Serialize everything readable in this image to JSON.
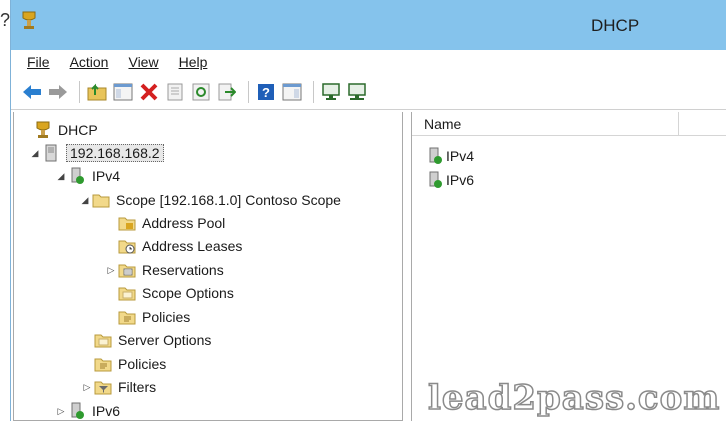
{
  "stray_char": "?",
  "window": {
    "title": "DHCP"
  },
  "menu": [
    {
      "label": "File"
    },
    {
      "label": "Action"
    },
    {
      "label": "View"
    },
    {
      "label": "Help"
    }
  ],
  "toolbar": {
    "buttons": [
      "back-icon",
      "forward-icon",
      "up-folder-icon",
      "show-hide-tree-icon",
      "delete-icon",
      "properties-icon",
      "refresh-icon",
      "export-icon",
      "help-icon",
      "show-hide-action-icon",
      "computer-icon",
      "computer-network-icon"
    ]
  },
  "tree": [
    {
      "label": "DHCP",
      "icon": "dhcp-root-icon",
      "twisty": "",
      "level": 0
    },
    {
      "label": "192.168.168.2",
      "icon": "server-icon",
      "twisty": "◢",
      "level": 1,
      "selected": true
    },
    {
      "label": "IPv4",
      "icon": "ipv4-icon",
      "twisty": "◢",
      "level": 2
    },
    {
      "label": "Scope [192.168.1.0] Contoso Scope",
      "icon": "scope-folder-icon",
      "twisty": "◢",
      "level": 3
    },
    {
      "label": "Address Pool",
      "icon": "address-pool-icon",
      "twisty": "",
      "level": 4
    },
    {
      "label": "Address Leases",
      "icon": "address-leases-icon",
      "twisty": "",
      "level": 4
    },
    {
      "label": "Reservations",
      "icon": "reservations-icon",
      "twisty": "▷",
      "level": 4
    },
    {
      "label": "Scope Options",
      "icon": "scope-options-icon",
      "twisty": "",
      "level": 4
    },
    {
      "label": "Policies",
      "icon": "policies-icon",
      "twisty": "",
      "level": 4
    },
    {
      "label": "Server Options",
      "icon": "server-options-icon",
      "twisty": "",
      "level": 3
    },
    {
      "label": "Policies",
      "icon": "policies-icon",
      "twisty": "",
      "level": 3
    },
    {
      "label": "Filters",
      "icon": "filters-icon",
      "twisty": "▷",
      "level": 3
    },
    {
      "label": "IPv6",
      "icon": "ipv6-icon",
      "twisty": "▷",
      "level": 2
    }
  ],
  "list": {
    "column": "Name",
    "rows": [
      {
        "label": "IPv4",
        "icon": "ipv4-icon"
      },
      {
        "label": "IPv6",
        "icon": "ipv6-icon"
      }
    ]
  },
  "watermark": "lead2pass.com"
}
